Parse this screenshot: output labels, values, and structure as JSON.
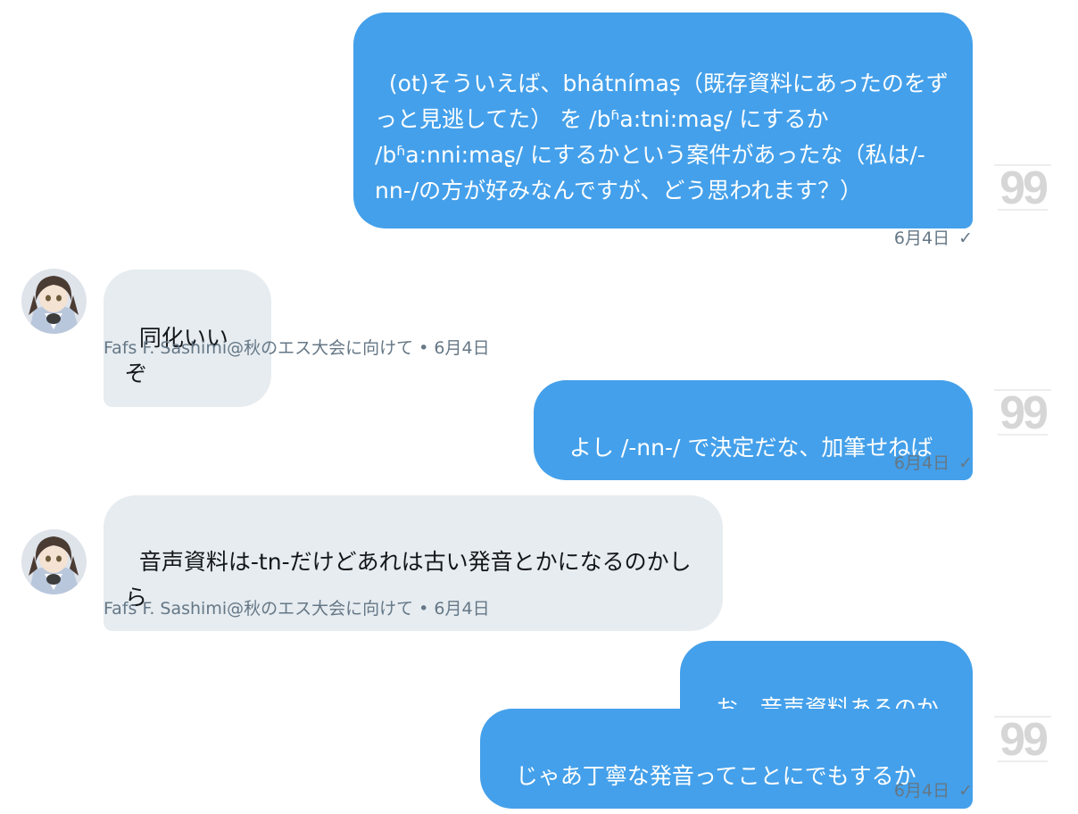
{
  "messages": [
    {
      "side": "sent",
      "text": "(ot)そういえば、bhátnímaṣ（既存資料にあったのをずっと見逃してた） を /bʱa:tni:maʂ/ にするか /bʱa:nni:maʂ/ にするかという案件があったな（私は/-nn-/の方が好みなんですが、どう思われます？）",
      "time": "6月4日",
      "status": "✓"
    },
    {
      "side": "received",
      "text": "同化いいぞ",
      "sender": "Fafs F. Sashimi@秋のエス大会に向けて",
      "time": "6月4日"
    },
    {
      "side": "sent",
      "text": "よし /-nn-/ で決定だな、加筆せねば",
      "time": "6月4日",
      "status": "✓"
    },
    {
      "side": "received",
      "text": "音声資料は-tn-だけどあれは古い発音とかになるのかしら",
      "sender": "Fafs F. Sashimi@秋のエス大会に向けて",
      "time": "6月4日"
    },
    {
      "side": "sent",
      "text": "お、音声資料あるのか"
    },
    {
      "side": "sent",
      "text": "じゃあ丁寧な発音ってことにでもするか",
      "time": "6月4日",
      "status": "✓"
    }
  ],
  "separator": " • ",
  "icons": {
    "sender_avatar": "sender-avatar",
    "own_avatar": "badge-99-icon"
  },
  "colors": {
    "sent_bubble": "#44a0ea",
    "received_bubble": "#e6ecf0",
    "meta_text": "#657786"
  }
}
